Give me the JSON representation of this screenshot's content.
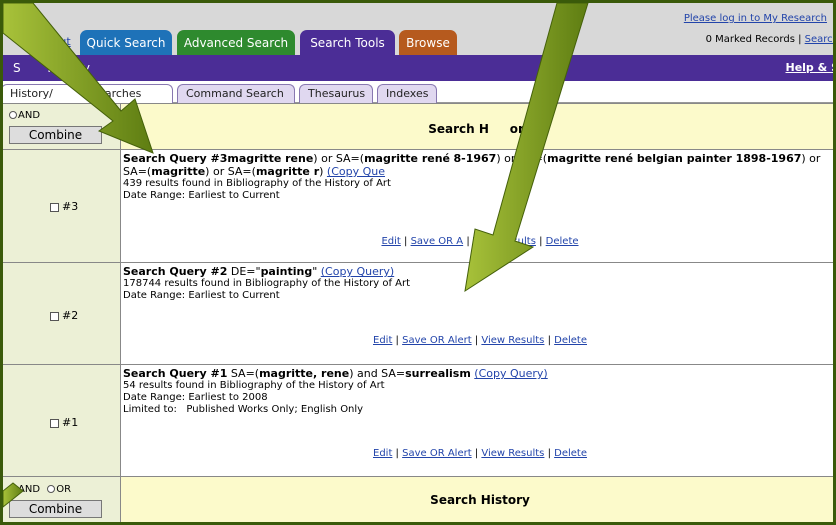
{
  "top": {
    "logout": "Logout",
    "login_link": "Please log in to My Research",
    "marked_count_text": "0 Marked Records | ",
    "search_link": "Search",
    "tabs": [
      {
        "label": "Quick Search",
        "color": "#1e72b8"
      },
      {
        "label": "Advanced Search",
        "color": "#2e8a2e"
      },
      {
        "label": "Search Tools",
        "color": "#4b2d96"
      },
      {
        "label": "Browse",
        "color": "#b65a1e"
      }
    ]
  },
  "purple": {
    "title": "S       History",
    "help": "Help & S"
  },
  "subtabs": [
    {
      "label": "History/        e Searches",
      "active": true
    },
    {
      "label": "Command Search",
      "active": false
    },
    {
      "label": "Thesaurus",
      "active": false
    },
    {
      "label": "Indexes",
      "active": false
    }
  ],
  "history": {
    "header_title": "Search H     ory",
    "footer_title": "Search History",
    "combine_label": "Combine",
    "and_label": "AND",
    "or_label": "OR",
    "queries": [
      {
        "check_label": "#3",
        "title": "Search Query #3",
        "query_pre": " SA=(",
        "query_rest_html": "<b>magritte rene</b>) or SA=(<b>magritte rené</b>     <b>8-1967</b>) or SA=(<b>magritte rené belgian painter 1898-1967</b>) or SA=(<b>magritte</b>) or SA=(<b>magritte r</b>) ",
        "copy": "(Copy Que",
        "results": " 439 results found in Bibliography of the History of Art",
        "date_range": "Date Range: Earliest to Current",
        "limited": "",
        "edit": "Edit",
        "save": "Save OR A",
        "view": "View Results",
        "delete": "Delete"
      },
      {
        "check_label": "#2",
        "title": "Search Query #2",
        "query_rest_html": " DE=\"<b>painting</b>\" ",
        "copy": "(Copy Query)",
        "results": " 178744 results found in Bibliography of the History of Art",
        "date_range": "Date Range: Earliest to Current",
        "limited": "",
        "edit": "Edit",
        "save": "Save OR Alert",
        "view": "View Results",
        "delete": "Delete"
      },
      {
        "check_label": "#1",
        "title": "Search Query #1",
        "query_rest_html": " SA=(<b>magritte, rene</b>) and SA=<b>surrealism</b> ",
        "copy": "(Copy Query)",
        "results": " 54 results found in Bibliography of the History of Art",
        "date_range": "Date Range: Earliest to 2008",
        "limited": "Limited to:   Published Works Only; English Only",
        "edit": "Edit",
        "save": "Save OR Alert",
        "view": "View Results",
        "delete": "Delete"
      }
    ]
  },
  "colors": {
    "arrow_light": "#a8c23a",
    "arrow_dark": "#5e7d12"
  }
}
